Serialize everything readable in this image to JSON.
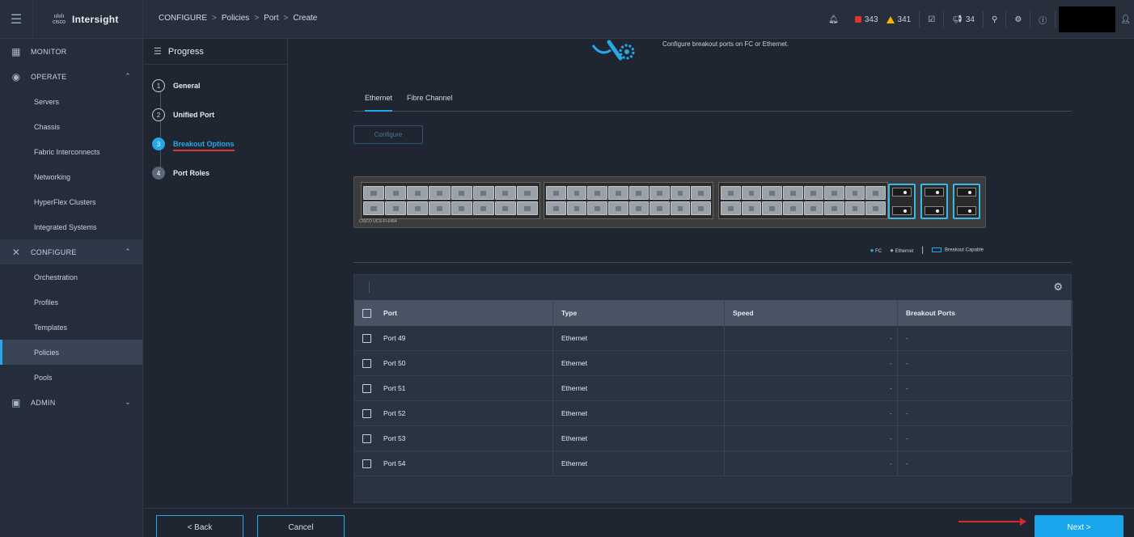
{
  "app": {
    "name": "Intersight",
    "logo_text": "cisco"
  },
  "breadcrumb": [
    "CONFIGURE",
    "Policies",
    "Port",
    "Create"
  ],
  "topbar": {
    "alarm_critical": "343",
    "alarm_warning": "341",
    "notifications": "34"
  },
  "sidebar": {
    "monitor": "MONITOR",
    "operate": "OPERATE",
    "operate_items": [
      "Servers",
      "Chassis",
      "Fabric Interconnects",
      "Networking",
      "HyperFlex Clusters",
      "Integrated Systems"
    ],
    "configure": "CONFIGURE",
    "configure_items": [
      "Orchestration",
      "Profiles",
      "Templates",
      "Policies",
      "Pools"
    ],
    "admin": "ADMIN"
  },
  "progress": {
    "title": "Progress",
    "steps": [
      {
        "num": "1",
        "label": "General"
      },
      {
        "num": "2",
        "label": "Unified Port"
      },
      {
        "num": "3",
        "label": "Breakout Options"
      },
      {
        "num": "4",
        "label": "Port Roles"
      }
    ]
  },
  "main": {
    "info_text": "Configure breakout ports on FC or Ethernet.",
    "tabs": [
      "Ethernet",
      "Fibre Channel"
    ],
    "configure_button": "Configure",
    "switch_model": "CISCO UCS-FI-6454",
    "legend": {
      "fc": "FC",
      "ethernet": "Ethernet",
      "breakout": "Breakout Capable"
    }
  },
  "table": {
    "headers": [
      "Port",
      "Type",
      "Speed",
      "Breakout Ports"
    ],
    "rows": [
      {
        "port": "Port 49",
        "type": "Ethernet",
        "speed": "-",
        "breakout": "-"
      },
      {
        "port": "Port 50",
        "type": "Ethernet",
        "speed": "-",
        "breakout": "-"
      },
      {
        "port": "Port 51",
        "type": "Ethernet",
        "speed": "-",
        "breakout": "-"
      },
      {
        "port": "Port 52",
        "type": "Ethernet",
        "speed": "-",
        "breakout": "-"
      },
      {
        "port": "Port 53",
        "type": "Ethernet",
        "speed": "-",
        "breakout": "-"
      },
      {
        "port": "Port 54",
        "type": "Ethernet",
        "speed": "-",
        "breakout": "-"
      }
    ]
  },
  "footer": {
    "back": "< Back",
    "cancel": "Cancel",
    "next": "Next >"
  },
  "icons": {
    "hamburger": "menu-icon",
    "bell": "bell-icon",
    "tasks": "tasks-icon",
    "megaphone": "announcement-icon",
    "search": "search-icon",
    "settings": "gear-icon",
    "help": "help-icon",
    "user": "user-icon"
  },
  "colors": {
    "accent": "#26a7e8",
    "critical": "#e2342f",
    "warning": "#f5b400",
    "next_button": "#1aa6ec"
  }
}
